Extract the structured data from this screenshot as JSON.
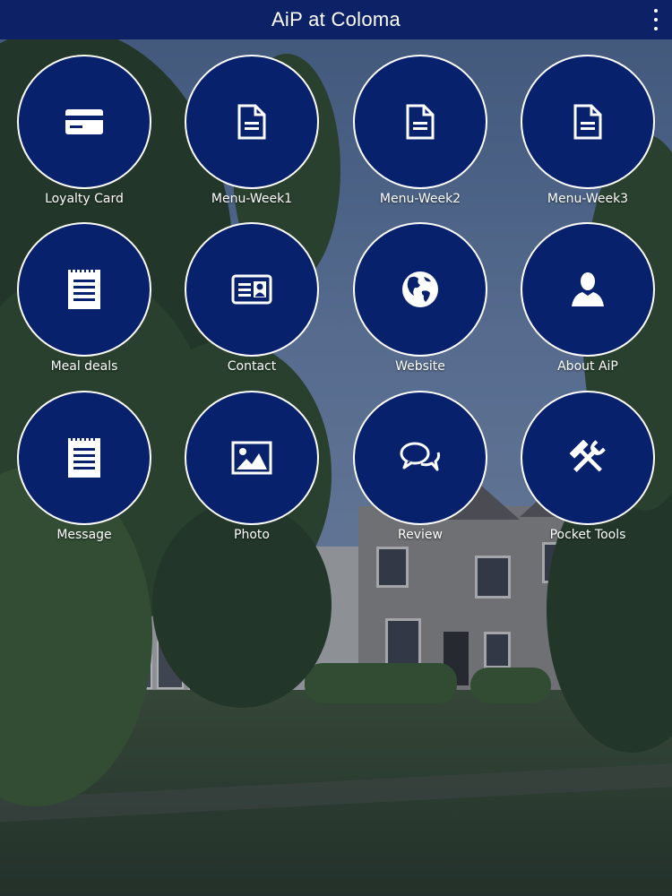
{
  "app": {
    "title": "AiP at Coloma"
  },
  "toolbar": {
    "overflow_icon": "more-vert-icon"
  },
  "tiles": [
    {
      "label": "Loyalty Card",
      "icon": "credit-card-icon"
    },
    {
      "label": "Menu-Week1",
      "icon": "document-icon"
    },
    {
      "label": "Menu-Week2",
      "icon": "document-icon"
    },
    {
      "label": "Menu-Week3",
      "icon": "document-icon"
    },
    {
      "label": "Meal deals",
      "icon": "notepad-icon"
    },
    {
      "label": "Contact",
      "icon": "contact-card-icon"
    },
    {
      "label": "Website",
      "icon": "globe-icon"
    },
    {
      "label": "About AiP",
      "icon": "person-icon"
    },
    {
      "label": "Message",
      "icon": "notepad-icon"
    },
    {
      "label": "Photo",
      "icon": "image-icon"
    },
    {
      "label": "Review",
      "icon": "chat-bubbles-icon"
    },
    {
      "label": "Pocket Tools",
      "icon": "tools-icon"
    }
  ],
  "colors": {
    "header": "#0c2166",
    "tile": "#07216d",
    "tile_border": "#ffffff",
    "text": "#ffffff"
  }
}
